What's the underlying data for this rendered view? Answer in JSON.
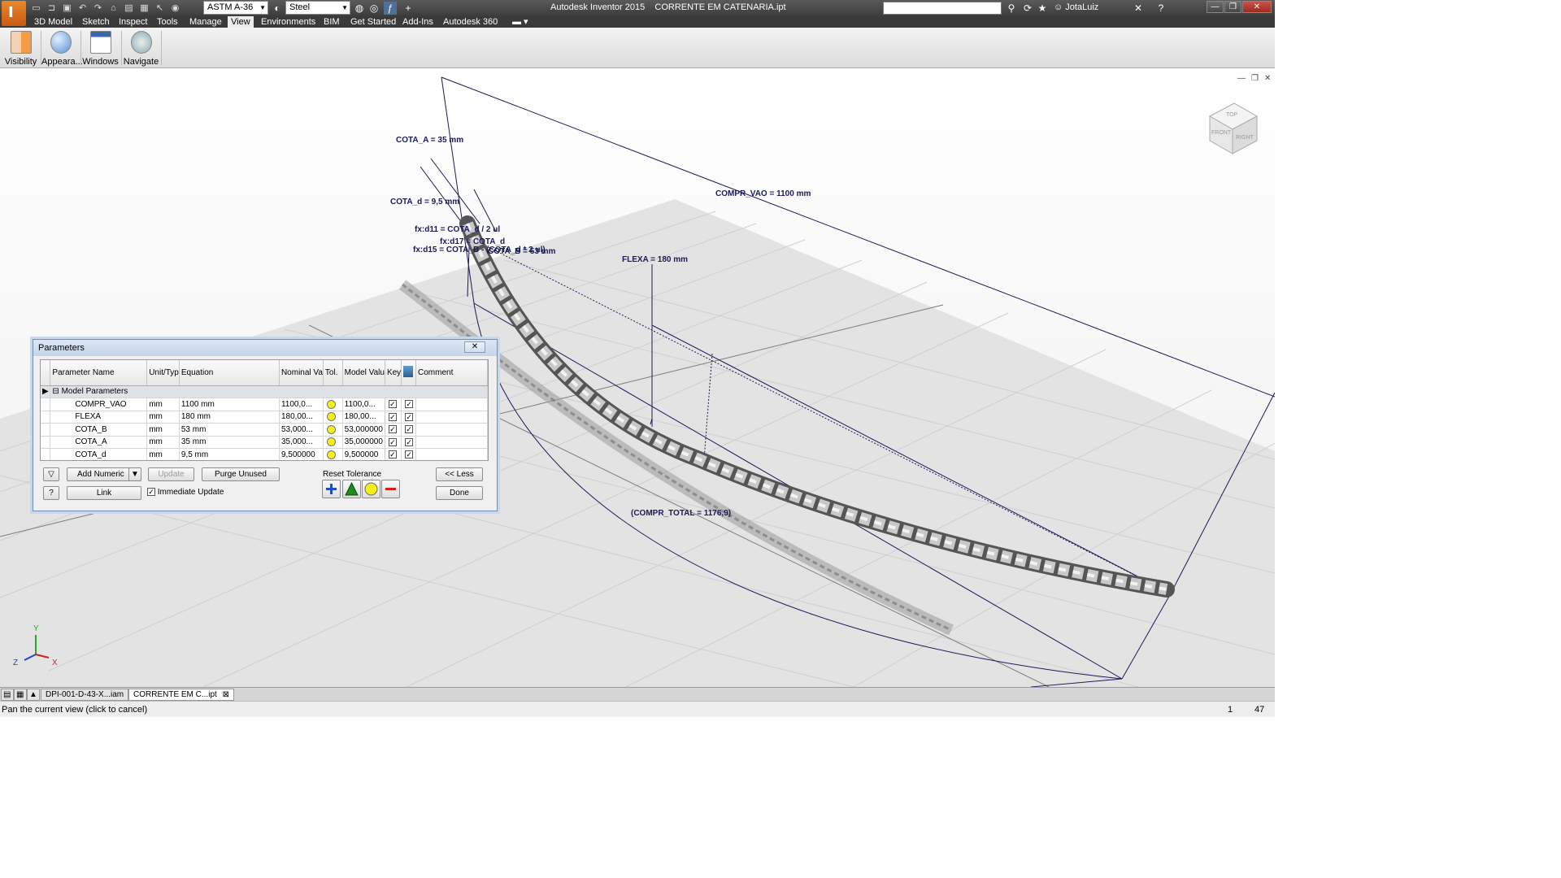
{
  "window": {
    "title": "Autodesk Inventor 2015    CORRENTE EM CATENARIA.ipt",
    "material": "ASTM A-36",
    "appearance": "Steel",
    "user": "JotaLuiz",
    "search_placeholder": ""
  },
  "menu": {
    "tabs": [
      "3D Model",
      "Sketch",
      "Inspect",
      "Tools",
      "Manage",
      "View",
      "Environments",
      "BIM",
      "Get Started",
      "Add-Ins",
      "Autodesk 360"
    ],
    "active": "View"
  },
  "ribbon": {
    "buttons": [
      {
        "label": "Visibility",
        "icon": "visibility-icon"
      },
      {
        "label": "Appeara...",
        "icon": "appearance-icon"
      },
      {
        "label": "Windows",
        "icon": "windows-icon"
      },
      {
        "label": "Navigate",
        "icon": "navigate-icon"
      }
    ]
  },
  "viewport": {
    "dimensions": {
      "cota_a": "COTA_A = 35 mm",
      "cota_d": "COTA_d = 9,5 mm",
      "fx_d11": "fx:d11 = COTA_d / 2 ul",
      "fx_d17": "fx:d17 = COTA_d",
      "fx_d15": "fx:d15 = COTA_B - (COTA_d * 2 ul)",
      "cota_b_ovl": "COTA_B = 53 mm",
      "compr_vao": "COMPR_VAO = 1100 mm",
      "flexa": "FLEXA = 180 mm",
      "compr_total": "(COMPR_TOTAL = 1176,9)"
    },
    "viewcube": {
      "top": "TOP",
      "front": "FRONT",
      "right": "RIGHT"
    },
    "axes": {
      "x": "X",
      "y": "Y",
      "z": "Z"
    }
  },
  "params": {
    "title": "Parameters",
    "columns": [
      "Parameter Name",
      "Unit/Typ",
      "Equation",
      "Nominal Va",
      "Tol.",
      "Model Valu",
      "Key",
      "",
      "Comment"
    ],
    "group": "Model Parameters",
    "rows": [
      {
        "name": "COMPR_VAO",
        "unit": "mm",
        "equation": "1100 mm",
        "nominal": "1100,0...",
        "model": "1100,0..."
      },
      {
        "name": "FLEXA",
        "unit": "mm",
        "equation": "180 mm",
        "nominal": "180,00...",
        "model": "180,00..."
      },
      {
        "name": "COTA_B",
        "unit": "mm",
        "equation": "53 mm",
        "nominal": "53,000...",
        "model": "53,000000"
      },
      {
        "name": "COTA_A",
        "unit": "mm",
        "equation": "35 mm",
        "nominal": "35,000...",
        "model": "35,000000"
      },
      {
        "name": "COTA_d",
        "unit": "mm",
        "equation": "9,5 mm",
        "nominal": "9,500000",
        "model": "9,500000"
      }
    ],
    "buttons": {
      "add_numeric": "Add Numeric",
      "update": "Update",
      "purge": "Purge Unused",
      "link": "Link",
      "immediate_update": "Immediate Update",
      "reset_tolerance": "Reset Tolerance",
      "less": "<< Less",
      "done": "Done"
    }
  },
  "doc_tabs": [
    "DPI-001-D-43-X...iam",
    "CORRENTE EM C...ipt"
  ],
  "status": {
    "message": "Pan the current view (click to cancel)",
    "count_a": "1",
    "count_b": "47"
  },
  "colors": {
    "dimension": "#1a1a5a",
    "tolerance_yellow": "#f7ef1a",
    "tolerance_green": "#1f8a1f",
    "tolerance_blue": "#1f4fbf",
    "tolerance_red": "#d31f1f"
  }
}
